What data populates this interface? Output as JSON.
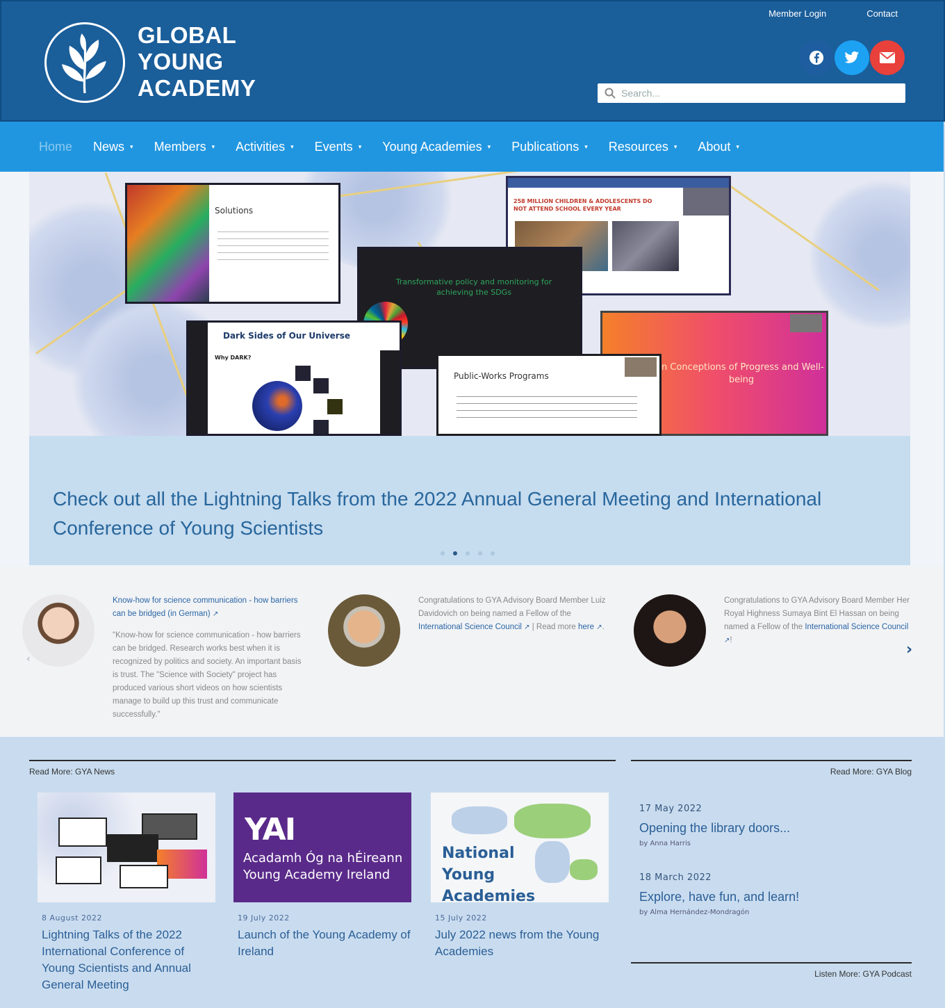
{
  "header": {
    "logo_lines": [
      "GLOBAL",
      "YOUNG",
      "ACADEMY"
    ],
    "member_login": "Member Login",
    "contact": "Contact",
    "search_placeholder": "Search...",
    "social": [
      "facebook-icon",
      "twitter-icon",
      "email-icon"
    ]
  },
  "nav": {
    "items": [
      {
        "label": "Home",
        "active": true
      },
      {
        "label": "News"
      },
      {
        "label": "Members"
      },
      {
        "label": "Activities"
      },
      {
        "label": "Events"
      },
      {
        "label": "Young Academies"
      },
      {
        "label": "Publications"
      },
      {
        "label": "Resources"
      },
      {
        "label": "About"
      }
    ]
  },
  "hero": {
    "slides": {
      "solutions_title": "Solutions",
      "dark_sides_title": "Dark Sides of Our Universe",
      "why_dark": "Why DARK?",
      "policy_title": "Transformative policy and monitoring for achieving the SDGs",
      "children_title": "258 MILLION CHILDREN & ADOLESCENTS DO NOT ATTEND SCHOOL EVERY YEAR",
      "public_works_title": "Public-Works Programs",
      "progress_title": "in Conceptions of Progress and Well-being"
    },
    "caption": "Check out all the Lightning Talks from the 2022 Annual General Meeting and International Conference of Young Scientists",
    "dots_count": 5,
    "active_dot": 1
  },
  "strip": {
    "cards": [
      {
        "title": "Know-how for science communication - how barriers can be bridged (in German)",
        "body": "\"Know-how for science communication - how barriers can be bridged. Research works best when it is recognized by politics and society. An important basis is trust. The \"Science with Society\" project has produced various short videos on how scientists manage to build up this trust and communicate successfully.\""
      },
      {
        "pre": "Congratulations to GYA Advisory Board Member Luiz Davidovich on being named a Fellow of the ",
        "link": "International Science Council",
        "mid": " | Read more ",
        "link2": "here",
        "post": "."
      },
      {
        "pre": "Congratulations to GYA Advisory Board Member Her Royal Highness Sumaya Bint El Hassan on being named a Fellow of the ",
        "link": "International Science Council",
        "post": "!"
      }
    ]
  },
  "bottom": {
    "news_label": "Read More: GYA News",
    "blog_label": "Read More: GYA Blog",
    "podcast_label": "Listen More: GYA Podcast",
    "news": [
      {
        "date": "8 August 2022",
        "title": "Lightning Talks of the 2022 International Conference of Young Scientists and Annual General Meeting"
      },
      {
        "date": "19 July 2022",
        "title": "Launch of the Young Academy of Ireland",
        "thumb_lines": [
          "Acadamh Óg na hÉireann",
          "Young Academy Ireland"
        ],
        "thumb_logo": "YAI"
      },
      {
        "date": "15 July 2022",
        "title": "July 2022 news from the Young Academies",
        "thumb_lines": [
          "National",
          "Young",
          "Academies"
        ]
      }
    ],
    "blog": [
      {
        "date": "17 May 2022",
        "title": "Opening the library doors...",
        "by": "by Anna Harris"
      },
      {
        "date": "18 March 2022",
        "title": "Explore, have fun, and learn!",
        "by": "by Alma Hernández-Mondragón"
      }
    ]
  }
}
